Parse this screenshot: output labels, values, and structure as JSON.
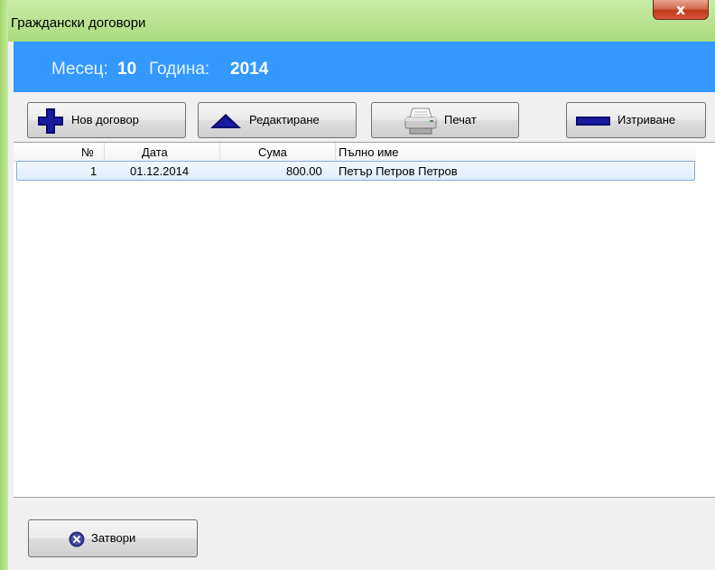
{
  "window": {
    "title": "Граждански договори",
    "close_symbol": "x"
  },
  "header": {
    "month_label": "Месец:",
    "month_value": "10",
    "year_label": "Година:",
    "year_value": "2014"
  },
  "toolbar": {
    "new_label": "Нов договор",
    "edit_label": "Редактиране",
    "print_label": "Печат",
    "delete_label": "Изтриване"
  },
  "table": {
    "columns": [
      "№",
      "Дата",
      "Сума",
      "Пълно име"
    ],
    "rows": [
      {
        "num": "1",
        "date": "01.12.2014",
        "amount": "800.00",
        "name": "Петър Петров Петров"
      }
    ]
  },
  "footer": {
    "close_label": "Затвори"
  },
  "icons": {
    "new": "plus-icon",
    "edit": "triangle-up-icon",
    "print": "printer-icon",
    "delete": "minus-icon",
    "close": "x-circle-icon"
  },
  "colors": {
    "header_band": "#3399ff",
    "titlebar": "#b7e28f",
    "icon_navy": "#0a0a6e"
  }
}
